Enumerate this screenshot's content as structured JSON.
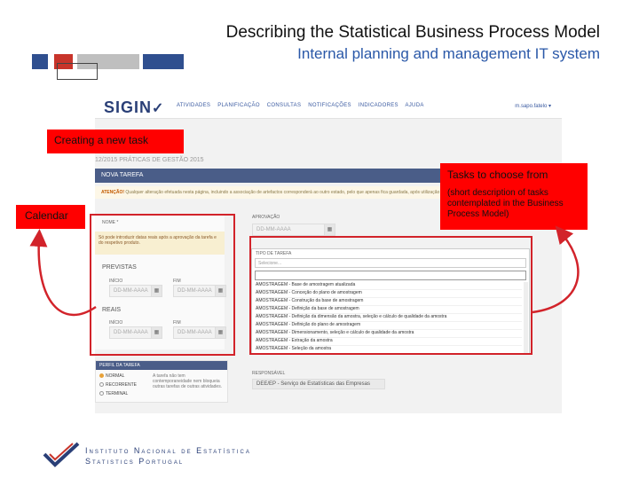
{
  "header": {
    "title": "Describing the Statistical Business Process Model",
    "subtitle": "Internal planning and management IT system"
  },
  "app": {
    "logo": "SIGIN",
    "nav_items": [
      "ATIVIDADES",
      "PLANIFICAÇÃO",
      "CONSULTAS",
      "NOTIFICAÇÕES",
      "INDICADORES",
      "AJUDA"
    ],
    "user": "m.sapo.fatelo ▾",
    "breadcrumb": "12/2015 PRÁTICAS DE GESTÃO 2015",
    "task_title": "NOVA TAREFA",
    "warning_label": "ATENÇÃO!",
    "warning_text": "Qualquer alteração efetuada nesta página, incluindo a associação de artefactos corresponderá ao outro estado, pelo que apenas fica guardada, após utilização do botão GRAVAR",
    "field_nome": "NOME *",
    "alert_text": "Só pode introduzir datas reais após a aprovação da tarefa e do respetivo produto.",
    "previstas": "PREVISTAS",
    "reais": "REAIS",
    "inicio": "INÍCIO",
    "fim": "FIM",
    "date_placeholder": "DD-MM-AAAA",
    "aprovacao": "APROVAÇÃO",
    "aprovacao_placeholder": "DD-MM-AAAA",
    "tipo_label": "TIPO DE TAREFA",
    "tipo_select": "Selecione...",
    "task_list": [
      "AMOSTRAGEM - Base de amostragem atualizada",
      "AMOSTRAGEM - Conceção do plano de amostragem",
      "AMOSTRAGEM - Construção da base de amostragem",
      "AMOSTRAGEM - Definição da base de amostragem",
      "AMOSTRAGEM - Definição da dimensão da amostra, seleção e cálculo de qualidade da amostra",
      "AMOSTRAGEM - Definição do plano de amostragem",
      "AMOSTRAGEM - Dimensionamento, seleção e cálculo de qualidade da amostra",
      "AMOSTRAGEM - Extração da amostra",
      "AMOSTRAGEM - Seleção da amostra"
    ],
    "perfil_title": "PERFIL DA TAREFA",
    "perfil_options": [
      "NORMAL",
      "RECORRENTE",
      "TERMINAL"
    ],
    "perfil_note": "A tarefa não tem contemporaneidade nem bloqueia outras tarefas de outras atividades.",
    "sde_label": "RESPONSÁVEL",
    "sde_value": "DEE/EP - Serviço de Estatísticas das Empresas"
  },
  "callouts": {
    "new_task": "Creating a new task",
    "calendar": "Calendar",
    "tasks_title": "Tasks to choose from",
    "tasks_desc": "(short description of tasks contemplated in the Business Process Model)"
  },
  "footer": {
    "line1": "Instituto Nacional de Estatística",
    "line2": "Statistics Portugal"
  },
  "colors": {
    "callout_red": "#ff0000",
    "frame_red": "#d2232a",
    "navy": "#2a3f77",
    "title_blue": "#2a58a8",
    "bar": "#4a5d88"
  }
}
